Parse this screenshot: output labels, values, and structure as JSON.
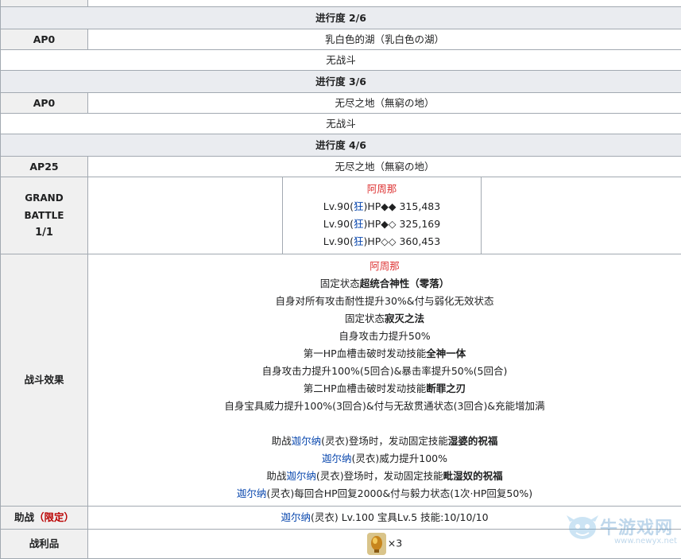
{
  "rows": {
    "p2": {
      "progress": "进行度 2/6",
      "ap": "AP0",
      "location": "乳白色的湖（乳白色の湖）",
      "battle": "无战斗"
    },
    "p3": {
      "progress": "进行度 3/6",
      "ap": "AP0",
      "location": "无尽之地（無窮の地）",
      "battle": "无战斗"
    },
    "p4": {
      "progress": "进行度 4/6",
      "ap": "AP25",
      "location": "无尽之地（無窮の地）",
      "grand": [
        "GRAND",
        "BATTLE",
        "1/1"
      ],
      "enemy_name": "阿周那",
      "enemies": [
        {
          "pre": "Lv.90(",
          "cls": "狂",
          "post": ")HP◆◆ 315,483"
        },
        {
          "pre": "Lv.90(",
          "cls": "狂",
          "post": ")HP◆◇ 325,169"
        },
        {
          "pre": "Lv.90(",
          "cls": "狂",
          "post": ")HP◇◇ 360,453"
        }
      ]
    }
  },
  "effects": {
    "label": "战斗效果",
    "boss": "阿周那",
    "l1_pre": "固定状态",
    "l1_b": "超统合神性（零落）",
    "l2": "自身对所有攻击耐性提升30%&付与弱化无效状态",
    "l3_pre": "固定状态",
    "l3_b": "寂灭之法",
    "l4": "自身攻击力提升50%",
    "l5_pre": "第一HP血槽击破时发动技能",
    "l5_b": "全神一体",
    "l6": "自身攻击力提升100%(5回合)&暴击率提升50%(5回合)",
    "l7_pre": "第二HP血槽击破时发动技能",
    "l7_b": "断罪之刃",
    "l8": "自身宝具威力提升100%(3回合)&付与无敌贯通状态(3回合)&充能增加满",
    "s1_a": "助战",
    "s1_link": "迦尔纳",
    "s1_b": "(灵衣)登场时，发动固定技能",
    "s1_bold": "湿婆的祝福",
    "s2_link": "迦尔纳",
    "s2_b": "(灵衣)威力提升100%",
    "s3_a": "助战",
    "s3_link": "迦尔纳",
    "s3_b": "(灵衣)登场时，发动固定技能",
    "s3_bold": "毗湿奴的祝福",
    "s4_link": "迦尔纳",
    "s4_b": "(灵衣)每回合HP回复2000&付与毅力状态(1次·HP回复50%)"
  },
  "support": {
    "label": "助战",
    "limited": "（限定）",
    "link": "迦尔纳",
    "text": "(灵衣) Lv.100 宝具Lv.5 技能:10/10/10"
  },
  "loot": {
    "label": "战利品",
    "count": "×3"
  },
  "watermark": {
    "name": "牛游戏网",
    "url": "www.newyx.net"
  }
}
